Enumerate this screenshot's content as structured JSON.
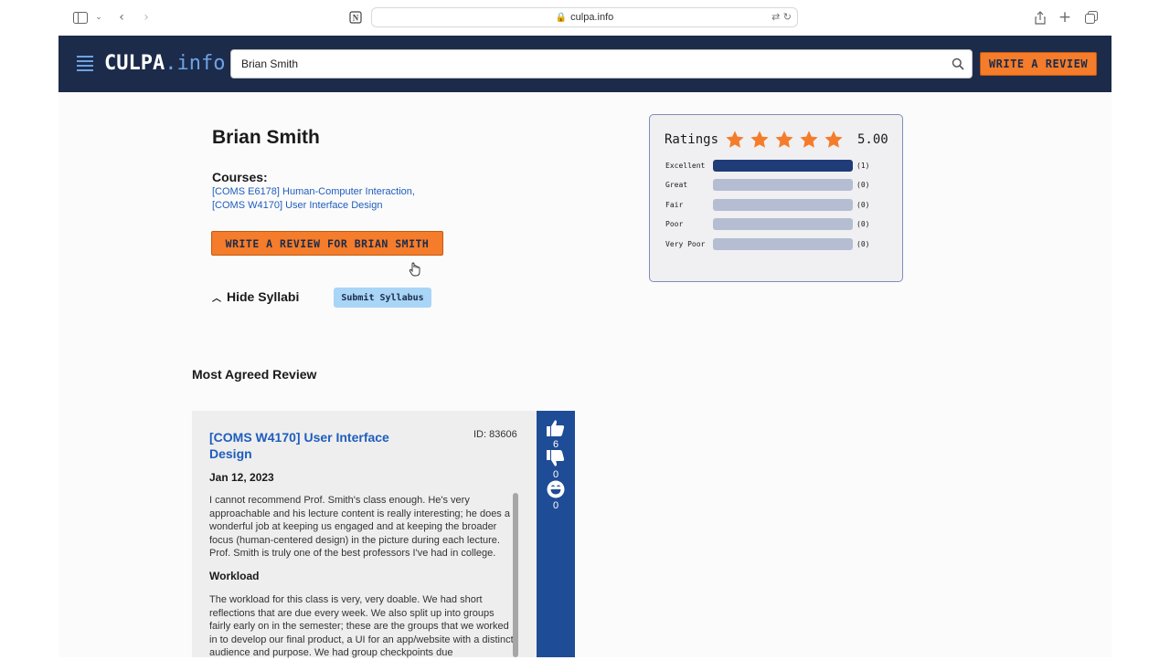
{
  "browser": {
    "url": "culpa.info"
  },
  "header": {
    "logo_main": "CULPA",
    "logo_suffix": ".info",
    "search_value": "Brian Smith",
    "write_review_label": "WRITE A REVIEW",
    "brand_color": "#1c2b4a",
    "accent_color": "#f47c2a"
  },
  "professor": {
    "name": "Brian Smith",
    "courses_label": "Courses:",
    "courses": [
      "[COMS E6178] Human-Computer Interaction,",
      "[COMS W4170] User Interface Design"
    ],
    "write_review_button": "WRITE A REVIEW FOR BRIAN SMITH",
    "hide_syllabi_label": "Hide Syllabi",
    "submit_syllabus_label": "Submit Syllabus"
  },
  "ratings": {
    "title": "Ratings",
    "stars": 5,
    "value": "5.00",
    "rows": [
      {
        "label": "Excellent",
        "count": "(1)",
        "fraction": 1
      },
      {
        "label": "Great",
        "count": "(0)",
        "fraction": 0
      },
      {
        "label": "Fair",
        "count": "(0)",
        "fraction": 0
      },
      {
        "label": "Poor",
        "count": "(0)",
        "fraction": 0
      },
      {
        "label": "Very Poor",
        "count": "(0)",
        "fraction": 0
      }
    ]
  },
  "most_agreed": {
    "heading": "Most Agreed Review",
    "course": "[COMS W4170] User Interface Design",
    "id": "ID: 83606",
    "date": "Jan 12, 2023",
    "body": "I cannot recommend Prof. Smith's class enough. He's very approachable and his lecture content is really interesting; he does a wonderful job at keeping us engaged and at keeping the broader focus (human-centered design) in the picture during each lecture. Prof. Smith is truly one of the best professors I've had in college.",
    "workload_heading": "Workload",
    "workload_body": "The workload for this class is very, very doable. We had short reflections that are due every week. We also split up into groups fairly early on in the semester; these are the groups that we worked in to develop our final product, a UI for an app/website with a distinct audience and purpose. We had group checkpoints due",
    "votes": {
      "agree": "6",
      "disagree": "0",
      "funny": "0"
    }
  }
}
